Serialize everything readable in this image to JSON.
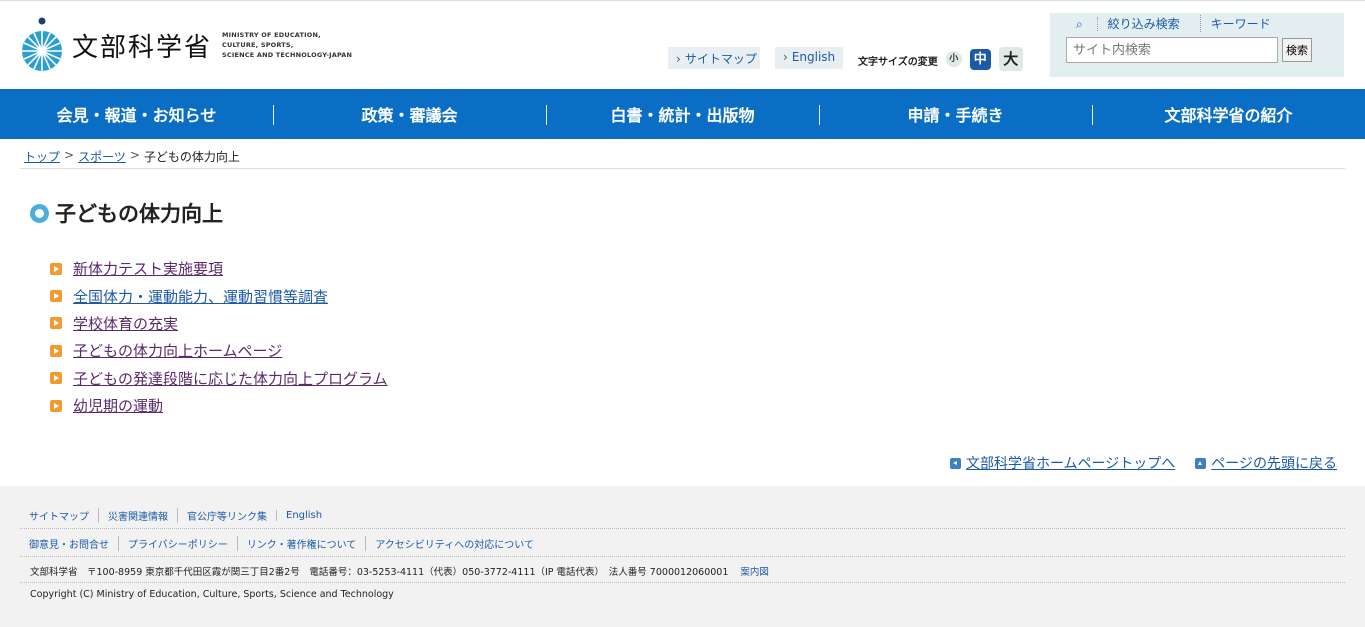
{
  "header": {
    "logo_title": "文部科学省",
    "logo_sub_1": "MINISTRY OF EDUCATION,",
    "logo_sub_2": "CULTURE, SPORTS,",
    "logo_sub_3": "SCIENCE AND TECHNOLOGY-JAPAN",
    "sitemap": "サイトマップ",
    "english": "English",
    "fontsize_label": "文字サイズの変更",
    "fontsize_small": "小",
    "fontsize_mid": "中",
    "fontsize_big": "大",
    "search_tab_1": "絞り込み検索",
    "search_tab_2": "キーワード",
    "search_placeholder": "サイト内検索",
    "search_button": "検索"
  },
  "nav": [
    "会見・報道・お知らせ",
    "政策・審議会",
    "白書・統計・出版物",
    "申請・手続き",
    "文部科学省の紹介"
  ],
  "breadcrumb": {
    "top": "トップ",
    "sports": "スポーツ",
    "current": "子どもの体力向上"
  },
  "page_title": "子どもの体力向上",
  "links": [
    "新体力テスト実施要項",
    "全国体力・運動能力、運動習慣等調査",
    "学校体育の充実",
    "子どもの体力向上ホームページ",
    "子どもの発達段階に応じた体力向上プログラム",
    "幼児期の運動"
  ],
  "page_links": {
    "home": "文部科学省ホームページトップへ",
    "top": "ページの先頭に戻る"
  },
  "footer": {
    "row1": [
      "サイトマップ",
      "災害関連情報",
      "官公庁等リンク集",
      "English"
    ],
    "row2": [
      "御意見・お問合せ",
      "プライバシーポリシー",
      "リンク・著作権について",
      "アクセシビリティへの対応について"
    ],
    "address": "文部科学省　〒100-8959 東京都千代田区霞が関三丁目2番2号　電話番号：03-5253-4111（代表）050-3772-4111（IP 電話代表）　法人番号 7000012060001",
    "map": "案内図",
    "copyright": "Copyright (C) Ministry of Education, Culture, Sports, Science and Technology"
  },
  "colors": {
    "nav_bg": "#0a6ec5",
    "link": "#1c5aa8",
    "visited": "#5a2a6b",
    "bullet": "#f29a2e"
  }
}
